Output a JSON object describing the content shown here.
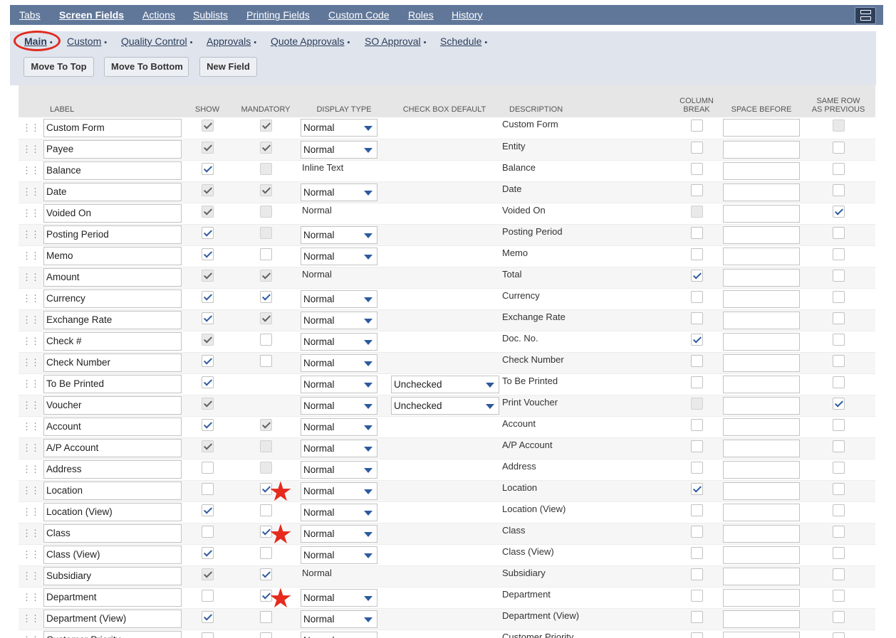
{
  "top_tabs": [
    {
      "label": "Tabs",
      "active": false
    },
    {
      "label": "Screen Fields",
      "active": true
    },
    {
      "label": "Actions",
      "active": false
    },
    {
      "label": "Sublists",
      "active": false
    },
    {
      "label": "Printing Fields",
      "active": false
    },
    {
      "label": "Custom Code",
      "active": false
    },
    {
      "label": "Roles",
      "active": false
    },
    {
      "label": "History",
      "active": false
    }
  ],
  "sub_tabs": [
    {
      "label": "Main",
      "active": true,
      "dot": "•"
    },
    {
      "label": "Custom",
      "active": false,
      "dot": "•"
    },
    {
      "label": "Quality Control",
      "active": false,
      "dot": "•"
    },
    {
      "label": "Approvals",
      "active": false,
      "dot": "•"
    },
    {
      "label": "Quote Approvals",
      "active": false,
      "dot": "•"
    },
    {
      "label": "SO Approval",
      "active": false,
      "dot": "•"
    },
    {
      "label": "Schedule",
      "active": false,
      "dot": "•"
    }
  ],
  "buttons": {
    "move_top": "Move To Top",
    "move_bottom": "Move To Bottom",
    "new_field": "New Field"
  },
  "columns": {
    "label": "LABEL",
    "show": "SHOW",
    "mandatory": "MANDATORY",
    "display_type": "DISPLAY TYPE",
    "checkbox_default": "CHECK BOX DEFAULT",
    "description": "DESCRIPTION",
    "column_break": "COLUMN BREAK",
    "space_before": "SPACE BEFORE",
    "same_row": "SAME ROW AS PREVIOUS"
  },
  "rows": [
    {
      "label": "Custom Form",
      "show": "checked-disabled",
      "mandatory": "checked-disabled",
      "display": "Normal",
      "display_select": true,
      "cb_default": "",
      "description": "Custom Form",
      "column_break": "unchecked",
      "space_before": "",
      "same_row": "unchecked-disabled",
      "starred": false
    },
    {
      "label": "Payee",
      "show": "checked-disabled",
      "mandatory": "checked-disabled",
      "display": "Normal",
      "display_select": true,
      "cb_default": "",
      "description": "Entity",
      "column_break": "unchecked",
      "space_before": "",
      "same_row": "unchecked",
      "starred": false
    },
    {
      "label": "Balance",
      "show": "checked",
      "mandatory": "unchecked-disabled",
      "display": "Inline Text",
      "display_select": false,
      "cb_default": "",
      "description": "Balance",
      "column_break": "unchecked",
      "space_before": "",
      "same_row": "unchecked",
      "starred": false
    },
    {
      "label": "Date",
      "show": "checked-disabled",
      "mandatory": "checked-disabled",
      "display": "Normal",
      "display_select": true,
      "cb_default": "",
      "description": "Date",
      "column_break": "unchecked",
      "space_before": "",
      "same_row": "unchecked",
      "starred": false
    },
    {
      "label": "Voided On",
      "show": "checked-disabled",
      "mandatory": "unchecked-disabled",
      "display": "Normal",
      "display_select": false,
      "cb_default": "",
      "description": "Voided On",
      "column_break": "unchecked-disabled",
      "space_before": "",
      "same_row": "checked",
      "starred": false
    },
    {
      "label": "Posting Period",
      "show": "checked",
      "mandatory": "unchecked-disabled",
      "display": "Normal",
      "display_select": true,
      "cb_default": "",
      "description": "Posting Period",
      "column_break": "unchecked",
      "space_before": "",
      "same_row": "unchecked",
      "starred": false
    },
    {
      "label": "Memo",
      "show": "checked",
      "mandatory": "unchecked",
      "display": "Normal",
      "display_select": true,
      "cb_default": "",
      "description": "Memo",
      "column_break": "unchecked",
      "space_before": "",
      "same_row": "unchecked",
      "starred": false
    },
    {
      "label": "Amount",
      "show": "checked-disabled",
      "mandatory": "checked-disabled",
      "display": "Normal",
      "display_select": false,
      "cb_default": "",
      "description": "Total",
      "column_break": "checked",
      "space_before": "",
      "same_row": "unchecked",
      "starred": false
    },
    {
      "label": "Currency",
      "show": "checked",
      "mandatory": "checked",
      "display": "Normal",
      "display_select": true,
      "cb_default": "",
      "description": "Currency",
      "column_break": "unchecked",
      "space_before": "",
      "same_row": "unchecked",
      "starred": false
    },
    {
      "label": "Exchange Rate",
      "show": "checked",
      "mandatory": "checked-disabled",
      "display": "Normal",
      "display_select": true,
      "cb_default": "",
      "description": "Exchange Rate",
      "column_break": "unchecked",
      "space_before": "",
      "same_row": "unchecked",
      "starred": false
    },
    {
      "label": "Check #",
      "show": "checked-disabled",
      "mandatory": "unchecked",
      "display": "Normal",
      "display_select": true,
      "cb_default": "",
      "description": "Doc. No.",
      "column_break": "checked",
      "space_before": "",
      "same_row": "unchecked",
      "starred": false
    },
    {
      "label": "Check Number",
      "show": "checked",
      "mandatory": "unchecked",
      "display": "Normal",
      "display_select": true,
      "cb_default": "",
      "description": "Check Number",
      "column_break": "unchecked",
      "space_before": "",
      "same_row": "unchecked",
      "starred": false
    },
    {
      "label": "To Be Printed",
      "show": "checked",
      "mandatory": "none",
      "display": "Normal",
      "display_select": true,
      "cb_default": "Unchecked",
      "description": "To Be Printed",
      "column_break": "unchecked",
      "space_before": "",
      "same_row": "unchecked",
      "starred": false
    },
    {
      "label": "Voucher",
      "show": "checked-disabled",
      "mandatory": "none",
      "display": "Normal",
      "display_select": true,
      "cb_default": "Unchecked",
      "description": "Print Voucher",
      "column_break": "unchecked-disabled",
      "space_before": "",
      "same_row": "checked",
      "starred": false
    },
    {
      "label": "Account",
      "show": "checked",
      "mandatory": "checked-disabled",
      "display": "Normal",
      "display_select": true,
      "cb_default": "",
      "description": "Account",
      "column_break": "unchecked",
      "space_before": "",
      "same_row": "unchecked",
      "starred": false
    },
    {
      "label": "A/P Account",
      "show": "checked-disabled",
      "mandatory": "unchecked-disabled",
      "display": "Normal",
      "display_select": true,
      "cb_default": "",
      "description": "A/P Account",
      "column_break": "unchecked",
      "space_before": "",
      "same_row": "unchecked",
      "starred": false
    },
    {
      "label": "Address",
      "show": "unchecked",
      "mandatory": "unchecked-disabled",
      "display": "Normal",
      "display_select": true,
      "cb_default": "",
      "description": "Address",
      "column_break": "unchecked",
      "space_before": "",
      "same_row": "unchecked",
      "starred": false
    },
    {
      "label": "Location",
      "show": "unchecked",
      "mandatory": "checked",
      "display": "Normal",
      "display_select": true,
      "cb_default": "",
      "description": "Location",
      "column_break": "checked",
      "space_before": "",
      "same_row": "unchecked",
      "starred": true
    },
    {
      "label": "Location (View)",
      "show": "checked",
      "mandatory": "unchecked",
      "display": "Normal",
      "display_select": true,
      "cb_default": "",
      "description": "Location (View)",
      "column_break": "unchecked",
      "space_before": "",
      "same_row": "unchecked",
      "starred": false
    },
    {
      "label": "Class",
      "show": "unchecked",
      "mandatory": "checked",
      "display": "Normal",
      "display_select": true,
      "cb_default": "",
      "description": "Class",
      "column_break": "unchecked",
      "space_before": "",
      "same_row": "unchecked",
      "starred": true
    },
    {
      "label": "Class (View)",
      "show": "checked",
      "mandatory": "unchecked",
      "display": "Normal",
      "display_select": true,
      "cb_default": "",
      "description": "Class (View)",
      "column_break": "unchecked",
      "space_before": "",
      "same_row": "unchecked",
      "starred": false
    },
    {
      "label": "Subsidiary",
      "show": "checked-disabled",
      "mandatory": "checked",
      "display": "Normal",
      "display_select": false,
      "cb_default": "",
      "description": "Subsidiary",
      "column_break": "unchecked",
      "space_before": "",
      "same_row": "unchecked",
      "starred": false
    },
    {
      "label": "Department",
      "show": "unchecked",
      "mandatory": "checked",
      "display": "Normal",
      "display_select": true,
      "cb_default": "",
      "description": "Department",
      "column_break": "unchecked",
      "space_before": "",
      "same_row": "unchecked",
      "starred": true
    },
    {
      "label": "Department (View)",
      "show": "checked",
      "mandatory": "unchecked",
      "display": "Normal",
      "display_select": true,
      "cb_default": "",
      "description": "Department (View)",
      "column_break": "unchecked",
      "space_before": "",
      "same_row": "unchecked",
      "starred": false
    },
    {
      "label": "Customer Priority",
      "show": "unchecked",
      "mandatory": "unchecked",
      "display": "Normal",
      "display_select": true,
      "cb_default": "",
      "description": "Customer Priority",
      "column_break": "unchecked",
      "space_before": "",
      "same_row": "unchecked",
      "starred": false
    }
  ],
  "icons": {
    "drag": "drag-handle-icon",
    "menu": "menu-icon",
    "dropdown": "chevron-down-icon",
    "annotation": "star-icon"
  },
  "colors": {
    "topbar": "#607799",
    "subpanel": "#dfe4ed",
    "annotation": "#e62a1d",
    "check": "#2d5a9e"
  }
}
